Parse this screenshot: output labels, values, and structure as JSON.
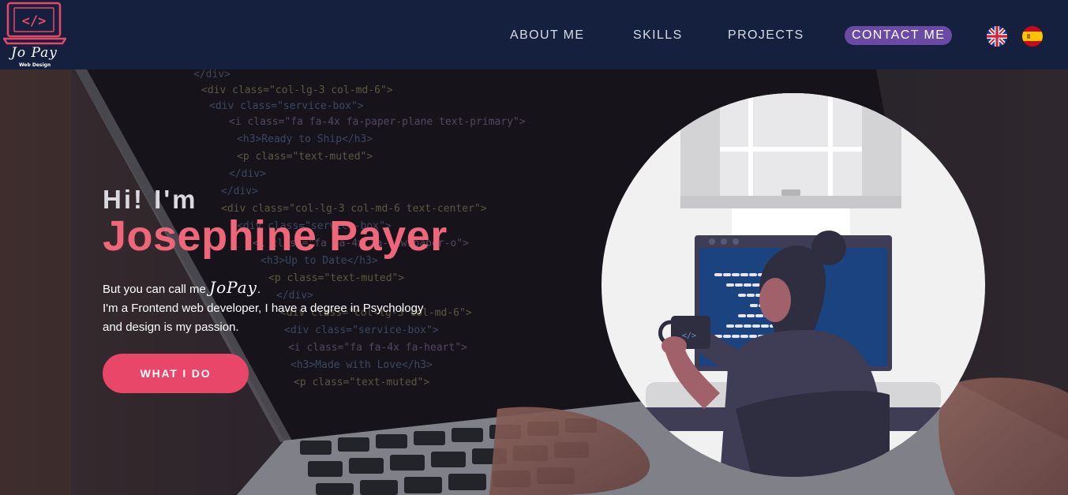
{
  "logo": {
    "icon": "code-brackets-laptop-icon",
    "symbol": "</>",
    "script_text": "Jo Pay",
    "subtitle": "Web Design",
    "accent_color": "#e9476a"
  },
  "nav": {
    "items": [
      {
        "label": "ABOUT ME"
      },
      {
        "label": "SKILLS"
      },
      {
        "label": "PROJECTS"
      },
      {
        "label": "CONTACT ME",
        "highlight_color": "#6a4aa4"
      }
    ],
    "languages": [
      {
        "icon": "uk-flag-icon"
      },
      {
        "icon": "spain-flag-icon"
      }
    ]
  },
  "hero": {
    "greeting": "Hi! I'm",
    "name": "Josephine Payer",
    "intro_prefix": "But you can call me",
    "intro_nickname": "JoPay",
    "intro_suffix": ".",
    "intro_line2": "I'm a Frontend web developer, I have a degree in Psychology",
    "intro_line3": "and design is my passion.",
    "cta_label": "WHAT I DO",
    "name_color": "#ef6579",
    "cta_color": "#e9476a",
    "illustration": "woman-at-computer-illustration",
    "background": "laptop-code-photo"
  }
}
